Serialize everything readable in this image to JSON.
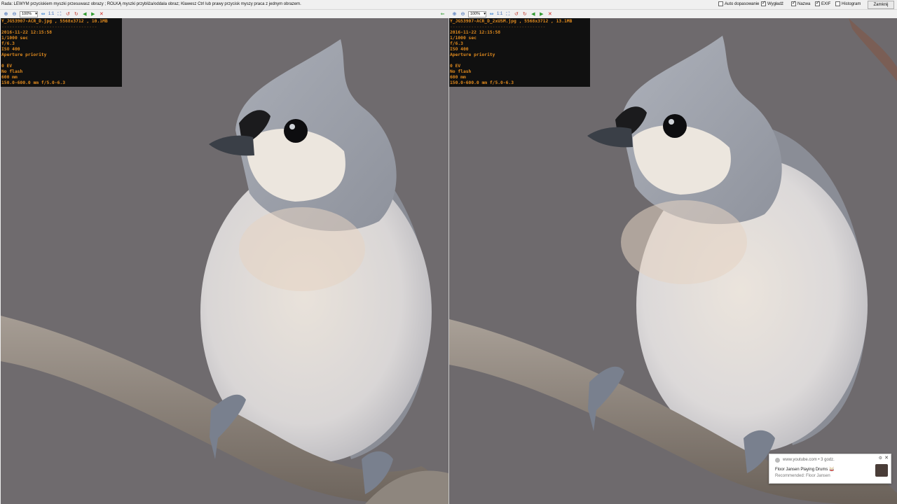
{
  "topbar": {
    "hint": "Rada: LEWYM przyciskiem myszki przesuwasz obrazy ; ROLKĄ myszki przybliża/oddala obraz; Klawesz Ctrl lub prawy przycisk myszy praca z jednym obrazem.",
    "options": [
      {
        "label": "Auto dopasowanie",
        "checked": false
      },
      {
        "label": "Wygładź",
        "checked": true
      },
      {
        "label": "Nazwa",
        "checked": true
      },
      {
        "label": "EXIF",
        "checked": true
      },
      {
        "label": "Histogram",
        "checked": false
      }
    ],
    "close_label": "Zamknij"
  },
  "toolbar": {
    "zoom_value": "100%",
    "one_to_one": "1:1"
  },
  "left": {
    "filename_line": "Y_JG53907-ACR_D.jpg , 5568x3712 , 10.1MB",
    "separator": "------------------------------------",
    "exif": [
      "2016-11-22 12:15:58",
      "1/1000 sec",
      "f/6.3",
      "ISO 400",
      "Aperture priority",
      "",
      "0 EV",
      "No flash",
      "600 mm",
      "150.0-600.0 mm f/5.0-6.3"
    ]
  },
  "right": {
    "filename_line": "Y_JG53907-ACR_D_2xUSM.jpg , 5568x3712 , 13.1MB",
    "separator": "------------------------------------",
    "exif": [
      "2016-11-22 12:15:58",
      "1/1000 sec",
      "f/6.3",
      "ISO 400",
      "Aperture priority",
      "",
      "0 EV",
      "No flash",
      "600 mm",
      "150.0-600.0 mm f/5.0-6.3"
    ]
  },
  "notification": {
    "source": "www.youtube.com • 3 godz.",
    "title": "Floor Jansen Playing Drums 🥁",
    "subtitle": "Recommended: Floor Jansen"
  },
  "colors": {
    "exif_text": "#e08a1e",
    "photo_bg": "#6f6b6e"
  }
}
